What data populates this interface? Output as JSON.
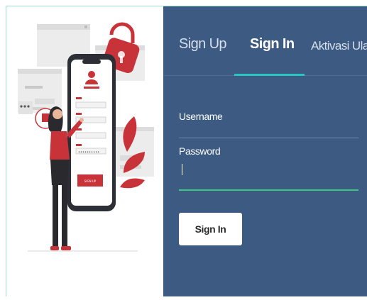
{
  "tabs": {
    "signup": "Sign Up",
    "signin": "Sign In",
    "aktivasi": "Aktivasi Ulang"
  },
  "form": {
    "username_label": "Username",
    "password_label": "Password",
    "submit_label": "Sign In"
  },
  "illustration": {
    "phone_button_label": "SIGN UP"
  },
  "colors": {
    "panel": "#3c5a82",
    "tab_indicator": "#27c6c0",
    "password_underline": "#3cc783",
    "accent_red": "#c8333a"
  }
}
